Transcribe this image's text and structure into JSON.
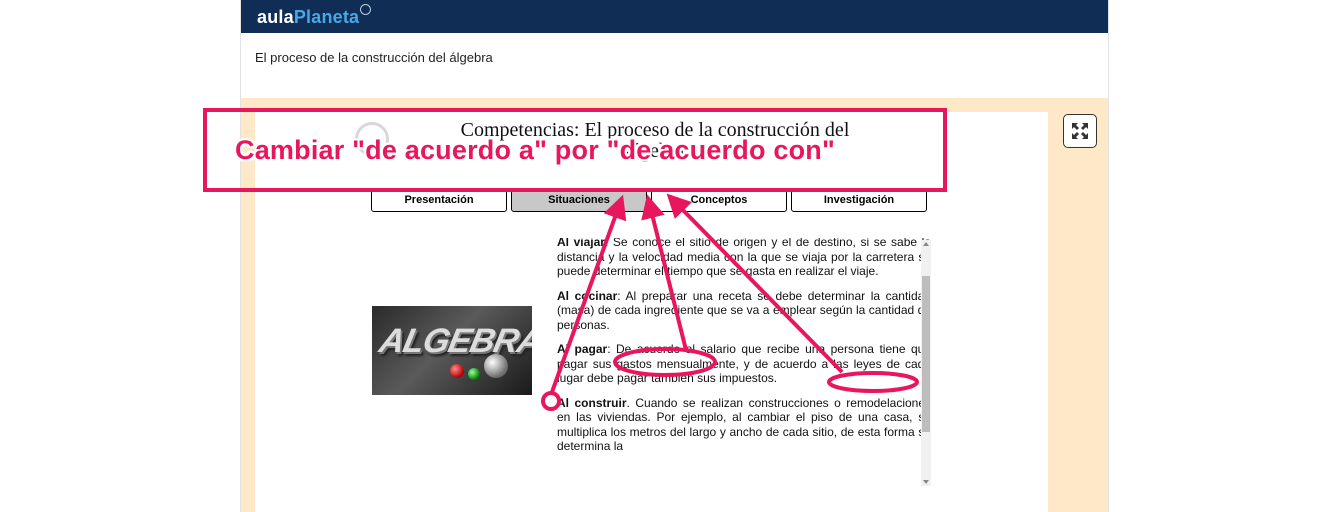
{
  "brand": {
    "part1": "aula",
    "part2": "Planeta"
  },
  "page": {
    "subtitle": "El proceso de la construcción del álgebra"
  },
  "activity": {
    "title": "Competencias: El proceso de la construcción del álgebra",
    "tabs": [
      {
        "label": "Presentación",
        "active": false
      },
      {
        "label": "Situaciones",
        "active": true
      },
      {
        "label": "Conceptos",
        "active": false
      },
      {
        "label": "Investigación",
        "active": false
      }
    ],
    "image_word": "ALGEBRA",
    "paragraphs": [
      {
        "bold": "Al viajar",
        "text": ": Se conoce el sitio de origen y el de destino, si se sabe la distancia y la velocidad media con la que se viaja por la carretera se puede determinar el tiempo que se gasta en realizar el viaje."
      },
      {
        "bold": "Al cocinar",
        "text": ": Al preparar una receta se debe determinar la cantidad (masa) de cada ingrediente que se va a emplear según la cantidad de personas."
      },
      {
        "bold": "Al pagar",
        "text": ": De acuerdo al salario que recibe una persona tiene que pagar sus gastos mensualmente, y de acuerdo a las leyes de cada lugar debe pagar también sus impuestos."
      },
      {
        "bold": "Al construir",
        "text": ". Cuando se realizan construcciones o remodelaciones en las viviendas. Por ejemplo, al cambiar el piso de una casa, se multiplica los metros del largo y ancho de cada sitio, de esta forma se determina la"
      }
    ]
  },
  "annotation": {
    "text": "Cambiar \"de acuerdo a\" por \"de acuerdo con\"",
    "color": "#e8175d"
  },
  "icons": {
    "fullscreen": "expand-arrows-icon"
  }
}
